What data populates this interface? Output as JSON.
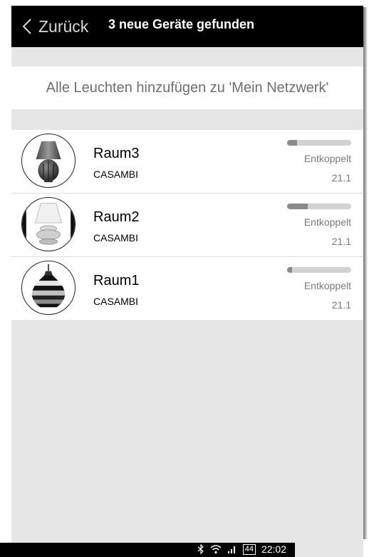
{
  "header": {
    "back_label": "Zurück",
    "title": "3 neue Geräte gefunden"
  },
  "add_all": {
    "label": "Alle Leuchten hinzufügen zu 'Mein Netzwerk'"
  },
  "devices": [
    {
      "name": "Raum3",
      "vendor": "CASAMBI",
      "status": "Entkoppelt",
      "version": "21.1",
      "signal": 0.15,
      "icon": "table-lamp-vase-icon"
    },
    {
      "name": "Raum2",
      "vendor": "CASAMBI",
      "status": "Entkoppelt",
      "version": "21.1",
      "signal": 0.32,
      "icon": "table-lamp-white-shade-icon"
    },
    {
      "name": "Raum1",
      "vendor": "CASAMBI",
      "status": "Entkoppelt",
      "version": "21.1",
      "signal": 0.08,
      "icon": "pendant-lamp-striped-icon"
    }
  ],
  "statusbar": {
    "battery": "44",
    "time": "22:02"
  }
}
